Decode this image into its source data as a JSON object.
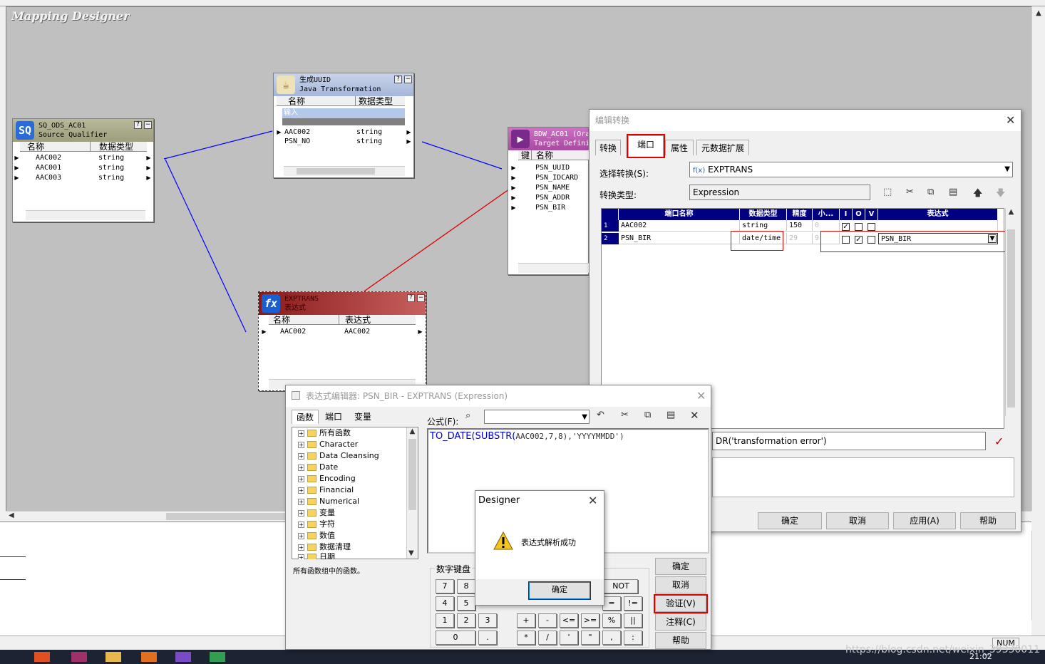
{
  "canvas": {
    "title": "Mapping Designer"
  },
  "nodes": {
    "sq": {
      "line1": "SQ_ODS_AC01",
      "line2": "Source Qualifier",
      "col_name": "名称",
      "col_type": "数据类型",
      "rows": [
        {
          "name": "AAC002",
          "type": "string"
        },
        {
          "name": "AAC001",
          "type": "string"
        },
        {
          "name": "AAC003",
          "type": "string"
        }
      ]
    },
    "java": {
      "line1": "生成UUID",
      "line2": "Java Transformation",
      "col_name": "名称",
      "col_type": "数据类型",
      "group": "输入",
      "rows": [
        {
          "name": "AAC002",
          "type": "string"
        },
        {
          "name": "PSN_NO",
          "type": "string"
        }
      ]
    },
    "target": {
      "line1": "BDW_AC01 (Ora",
      "line2": "Target Defini",
      "col_name": "名称",
      "col_key": "键",
      "rows": [
        "PSN_UUID",
        "PSN_IDCARD",
        "PSN_NAME",
        "PSN_ADDR",
        "PSN_BIR"
      ]
    },
    "exp": {
      "line1": "EXPTRANS",
      "line2": "表达式",
      "col_name": "名称",
      "col_expr": "表达式",
      "rows": [
        {
          "name": "AAC002",
          "expr": "AAC002"
        }
      ]
    }
  },
  "edit_dialog": {
    "title": "编辑转换",
    "tabs": [
      "转换",
      "端口",
      "属性",
      "元数据扩展"
    ],
    "active_tab": "端口",
    "select_label": "选择转换(S):",
    "select_value": "EXPTRANS",
    "select_icon": "f(x)",
    "type_label": "转换类型:",
    "type_value": "Expression",
    "grid_headers": {
      "port_name": "端口名称",
      "data_type": "数据类型",
      "precision": "精度",
      "scale": "小...",
      "i": "I",
      "o": "O",
      "v": "V",
      "expr": "表达式"
    },
    "rows": [
      {
        "num": "1",
        "name": "AAC002",
        "type": "string",
        "precision": "150",
        "scale": "0",
        "i": true,
        "o": true,
        "v": false,
        "expr": ""
      },
      {
        "num": "2",
        "name": "PSN_BIR",
        "type": "date/time",
        "precision": "29",
        "scale": "9",
        "i": false,
        "o": true,
        "v": false,
        "expr": "PSN_BIR"
      }
    ],
    "error_text": "DR('transformation error')",
    "buttons": {
      "ok": "确定",
      "cancel": "取消",
      "apply": "应用(A)",
      "help": "帮助"
    }
  },
  "expr_editor": {
    "title": "表达式编辑器: PSN_BIR - EXPTRANS (Expression)",
    "tabs": [
      "函数",
      "端口",
      "变量"
    ],
    "formula_label": "公式(F):",
    "formula": {
      "fn1": "TO_DATE(",
      "fn2": "SUBSTR(",
      "args": "AAC002,7,8),'YYYYMMDD')"
    },
    "tree": [
      "所有函数",
      "Character",
      "Data Cleansing",
      "Date",
      "Encoding",
      "Financial",
      "Numerical",
      "变量",
      "字符",
      "数值",
      "数据清理",
      "日期"
    ],
    "description": "所有函数组中的函数。",
    "keypad_label": "数字键盘",
    "keys": [
      "7",
      "8",
      "4",
      "5",
      "1",
      "2",
      "3",
      "0",
      "."
    ],
    "op_keys": {
      "not": "NOT",
      "eq": "=",
      "ne": "!=",
      "plus": "+",
      "minus": "-",
      "le": "<=",
      "ge": ">=",
      "pct": "%",
      "or": "||",
      "mul": "*",
      "div": "/",
      "sq": "'",
      "dq": "\"",
      "comma": ",",
      "colon": ":"
    },
    "buttons": {
      "ok": "确定",
      "cancel": "取消",
      "validate": "验证(V)",
      "comment": "注释(C)",
      "help": "帮助"
    }
  },
  "message_box": {
    "title": "Designer",
    "message": "表达式解析成功",
    "ok": "确定"
  },
  "status": {
    "num": "NUM",
    "watermark": "https://blog.csdn.net/weixin_39330011",
    "time": "21:02"
  }
}
